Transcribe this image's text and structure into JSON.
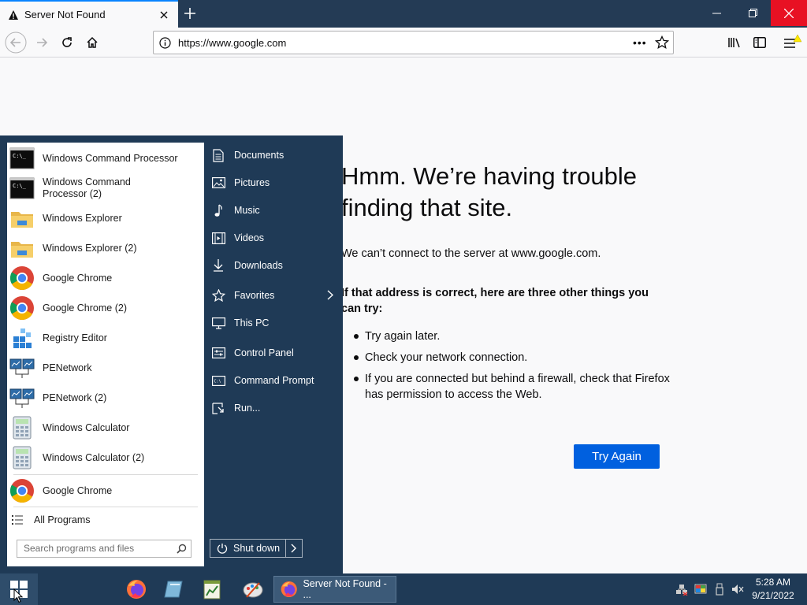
{
  "browser": {
    "tab_title": "Server Not Found",
    "url": "https://www.google.com",
    "page_actions_label": "•••"
  },
  "error_page": {
    "title": "Hmm. We’re having trouble finding that site.",
    "description": "We can’t connect to the server at www.google.com.",
    "hint": "If that address is correct, here are three other things you can try:",
    "suggestions": [
      "Try again later.",
      "Check your network connection.",
      "If you are connected but behind a firewall, check that Firefox has permission to access the Web."
    ],
    "try_again_label": "Try Again",
    "accent_color": "#0060df"
  },
  "start_menu": {
    "programs": [
      {
        "label": "Windows Command Processor",
        "icon": "cmd-icon"
      },
      {
        "label": "Windows Command Processor (2)",
        "icon": "cmd-icon"
      },
      {
        "label": "Windows Explorer",
        "icon": "folder-icon"
      },
      {
        "label": "Windows Explorer (2)",
        "icon": "folder-icon"
      },
      {
        "label": "Google Chrome",
        "icon": "chrome-icon"
      },
      {
        "label": "Google Chrome (2)",
        "icon": "chrome-icon"
      },
      {
        "label": "Registry Editor",
        "icon": "registry-icon"
      },
      {
        "label": "PENetwork",
        "icon": "network-icon"
      },
      {
        "label": "PENetwork (2)",
        "icon": "network-icon"
      },
      {
        "label": "Windows Calculator",
        "icon": "calculator-icon"
      },
      {
        "label": "Windows Calculator (2)",
        "icon": "calculator-icon"
      }
    ],
    "pinned": {
      "label": "Google Chrome",
      "icon": "chrome-icon"
    },
    "all_programs_label": "All Programs",
    "search_placeholder": "Search programs and files",
    "places": [
      {
        "label": "Documents",
        "icon": "documents-icon"
      },
      {
        "label": "Pictures",
        "icon": "pictures-icon"
      },
      {
        "label": "Music",
        "icon": "music-icon"
      },
      {
        "label": "Videos",
        "icon": "videos-icon"
      },
      {
        "label": "Downloads",
        "icon": "downloads-icon"
      },
      {
        "label": "Favorites",
        "icon": "star-icon"
      },
      {
        "label": "This PC",
        "icon": "computer-icon"
      },
      {
        "label": "Control Panel",
        "icon": "control-panel-icon"
      },
      {
        "label": "Command Prompt",
        "icon": "cmd-icon"
      },
      {
        "label": "Run...",
        "icon": "run-icon"
      }
    ],
    "shutdown_label": "Shut down",
    "background_color": "#1f3a56"
  },
  "taskbar": {
    "active_window_label": "Server Not Found - ...",
    "time": "5:28 AM",
    "date": "9/21/2022"
  }
}
